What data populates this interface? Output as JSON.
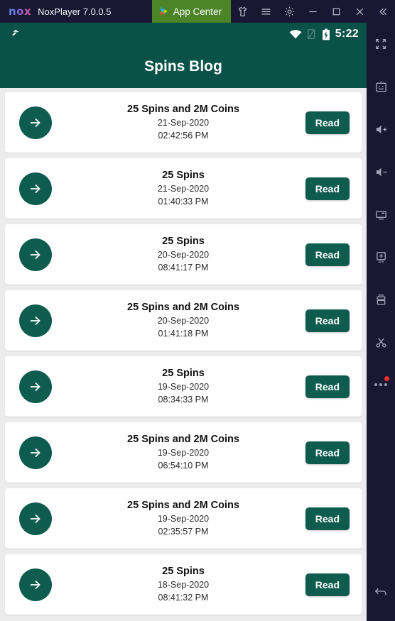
{
  "window": {
    "logo_text": "nox",
    "title": "NoxPlayer 7.0.0.5",
    "app_center_label": "App Center",
    "controls": [
      {
        "name": "theme-shirt-icon",
        "label": "Theme"
      },
      {
        "name": "menu-icon",
        "label": "Menu"
      },
      {
        "name": "settings-gear-icon",
        "label": "Settings"
      },
      {
        "name": "minimize-icon",
        "label": "Minimize"
      },
      {
        "name": "maximize-icon",
        "label": "Maximize"
      },
      {
        "name": "close-icon",
        "label": "Close"
      },
      {
        "name": "collapse-icon",
        "label": "Collapse"
      }
    ]
  },
  "status_bar": {
    "notification_icon": "app-notification-icon",
    "wifi_icon": "wifi-icon",
    "signal_icon": "no-sim-signal-icon",
    "battery_icon": "battery-charging-icon",
    "time": "5:22"
  },
  "app_bar": {
    "title": "Spins Blog"
  },
  "list": {
    "arrow_icon": "arrow-right-icon",
    "read_label": "Read",
    "items": [
      {
        "title": "25 Spins and 2M Coins",
        "date": "21-Sep-2020",
        "time": "02:42:56 PM"
      },
      {
        "title": "25 Spins",
        "date": "21-Sep-2020",
        "time": "01:40:33 PM"
      },
      {
        "title": "25 Spins",
        "date": "20-Sep-2020",
        "time": "08:41:17 PM"
      },
      {
        "title": "25 Spins and 2M Coins",
        "date": "20-Sep-2020",
        "time": "01:41:18 PM"
      },
      {
        "title": "25 Spins",
        "date": "19-Sep-2020",
        "time": "08:34:33 PM"
      },
      {
        "title": "25 Spins and 2M Coins",
        "date": "19-Sep-2020",
        "time": "06:54:10 PM"
      },
      {
        "title": "25 Spins and 2M Coins",
        "date": "19-Sep-2020",
        "time": "02:35:57 PM"
      },
      {
        "title": "25 Spins",
        "date": "18-Sep-2020",
        "time": "08:41:32 PM"
      }
    ]
  },
  "sidebar": {
    "items": [
      {
        "name": "fullscreen-icon",
        "label": "Fullscreen"
      },
      {
        "name": "keyboard-icon",
        "label": "Keyboard"
      },
      {
        "name": "volume-up-icon",
        "label": "Volume up"
      },
      {
        "name": "volume-down-icon",
        "label": "Volume down"
      },
      {
        "name": "screen-icon",
        "label": "Screen"
      },
      {
        "name": "install-apk-icon",
        "label": "Install APK"
      },
      {
        "name": "multi-instance-icon",
        "label": "Multi-instance"
      },
      {
        "name": "screenshot-cut-icon",
        "label": "Screenshot"
      },
      {
        "name": "more-options-icon",
        "label": "More"
      },
      {
        "name": "back-icon",
        "label": "Back"
      }
    ]
  },
  "colors": {
    "brand_green": "#0a5248",
    "accent_teal": "#0d5c4e",
    "titlebar": "#181833",
    "app_center_green": "#4c8527",
    "list_background": "#ececec",
    "badge_red": "#f02c2c"
  }
}
